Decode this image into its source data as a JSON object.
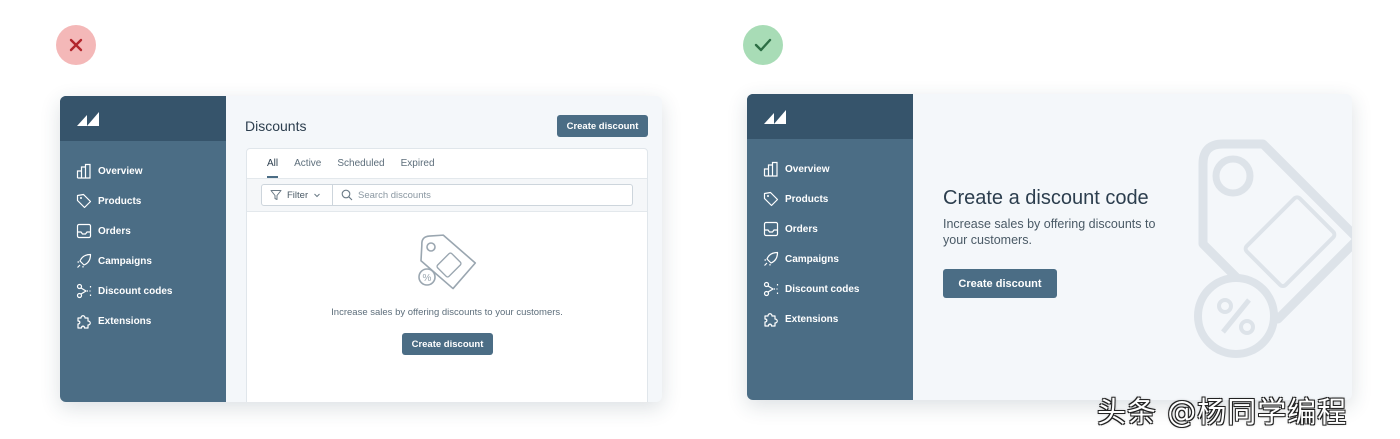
{
  "colors": {
    "bad": "#f4b8b8",
    "good": "#a8dcb6",
    "sidebar": "#4b6d85",
    "sidebar_head": "#36546b",
    "button": "#4b6d85"
  },
  "badges": {
    "bad_icon": "x-icon",
    "good_icon": "check-icon"
  },
  "left_example": {
    "sidebar": {
      "items": [
        {
          "label": "Overview",
          "icon": "bar-chart-icon"
        },
        {
          "label": "Products",
          "icon": "tag-icon"
        },
        {
          "label": "Orders",
          "icon": "inbox-icon"
        },
        {
          "label": "Campaigns",
          "icon": "rocket-icon"
        },
        {
          "label": "Discount codes",
          "icon": "scissors-icon"
        },
        {
          "label": "Extensions",
          "icon": "puzzle-icon"
        }
      ]
    },
    "main": {
      "title": "Discounts",
      "create_button": "Create discount",
      "tabs": [
        "All",
        "Active",
        "Scheduled",
        "Expired"
      ],
      "filter_label": "Filter",
      "search_placeholder": "Search discounts",
      "empty_text": "Increase sales by offering discounts to your customers.",
      "empty_button": "Create discount"
    }
  },
  "right_example": {
    "sidebar": {
      "items": [
        {
          "label": "Overview",
          "icon": "bar-chart-icon"
        },
        {
          "label": "Products",
          "icon": "tag-icon"
        },
        {
          "label": "Orders",
          "icon": "inbox-icon"
        },
        {
          "label": "Campaigns",
          "icon": "rocket-icon"
        },
        {
          "label": "Discount codes",
          "icon": "scissors-icon"
        },
        {
          "label": "Extensions",
          "icon": "puzzle-icon"
        }
      ]
    },
    "main": {
      "title": "Create a discount code",
      "description": "Increase sales by offering discounts to your customers.",
      "button": "Create discount"
    }
  },
  "watermark": "头条 @杨同学编程"
}
